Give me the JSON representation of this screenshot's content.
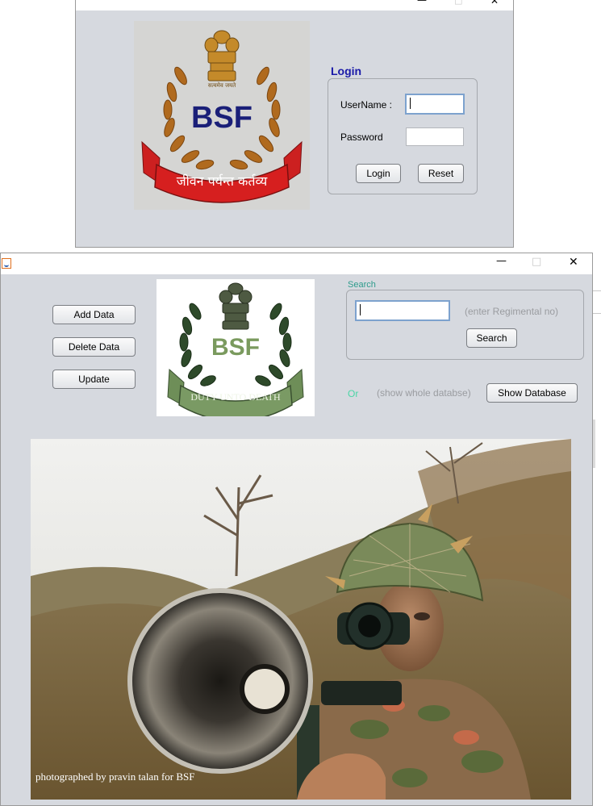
{
  "login_window": {
    "controls": {
      "minimize": "—",
      "maximize": "□",
      "close": "✕"
    },
    "logo": {
      "top_text": "सत्यमेव जयते",
      "emblem_text": "BSF",
      "banner_text": "जीवन पर्यन्त कर्तव्य"
    },
    "login_title": "Login",
    "username_label": "UserName :",
    "username_value": "",
    "password_label": "Password",
    "password_value": "",
    "login_button": "Login",
    "reset_button": "Reset"
  },
  "main_window": {
    "controls": {
      "minimize": "—",
      "maximize": "□",
      "close": "✕"
    },
    "buttons": {
      "add": "Add Data",
      "delete": "Delete Data",
      "update": "Update"
    },
    "logo": {
      "emblem_text": "BSF",
      "banner_text": "DUTY UNTO DEATH"
    },
    "search": {
      "label": "Search",
      "input_value": "",
      "hint": "(enter Regimental no)",
      "button": "Search"
    },
    "or_label": "Or",
    "show_hint": "(show whole databse)",
    "show_button": "Show Database",
    "photo_caption": "photographed by pravin talan for BSF"
  },
  "colors": {
    "window_bg": "#d6d9df",
    "login_title": "#1a1aa8",
    "search_label": "#2e9c8c",
    "or_label": "#4bd6a6",
    "hint": "#9a9ca0"
  }
}
